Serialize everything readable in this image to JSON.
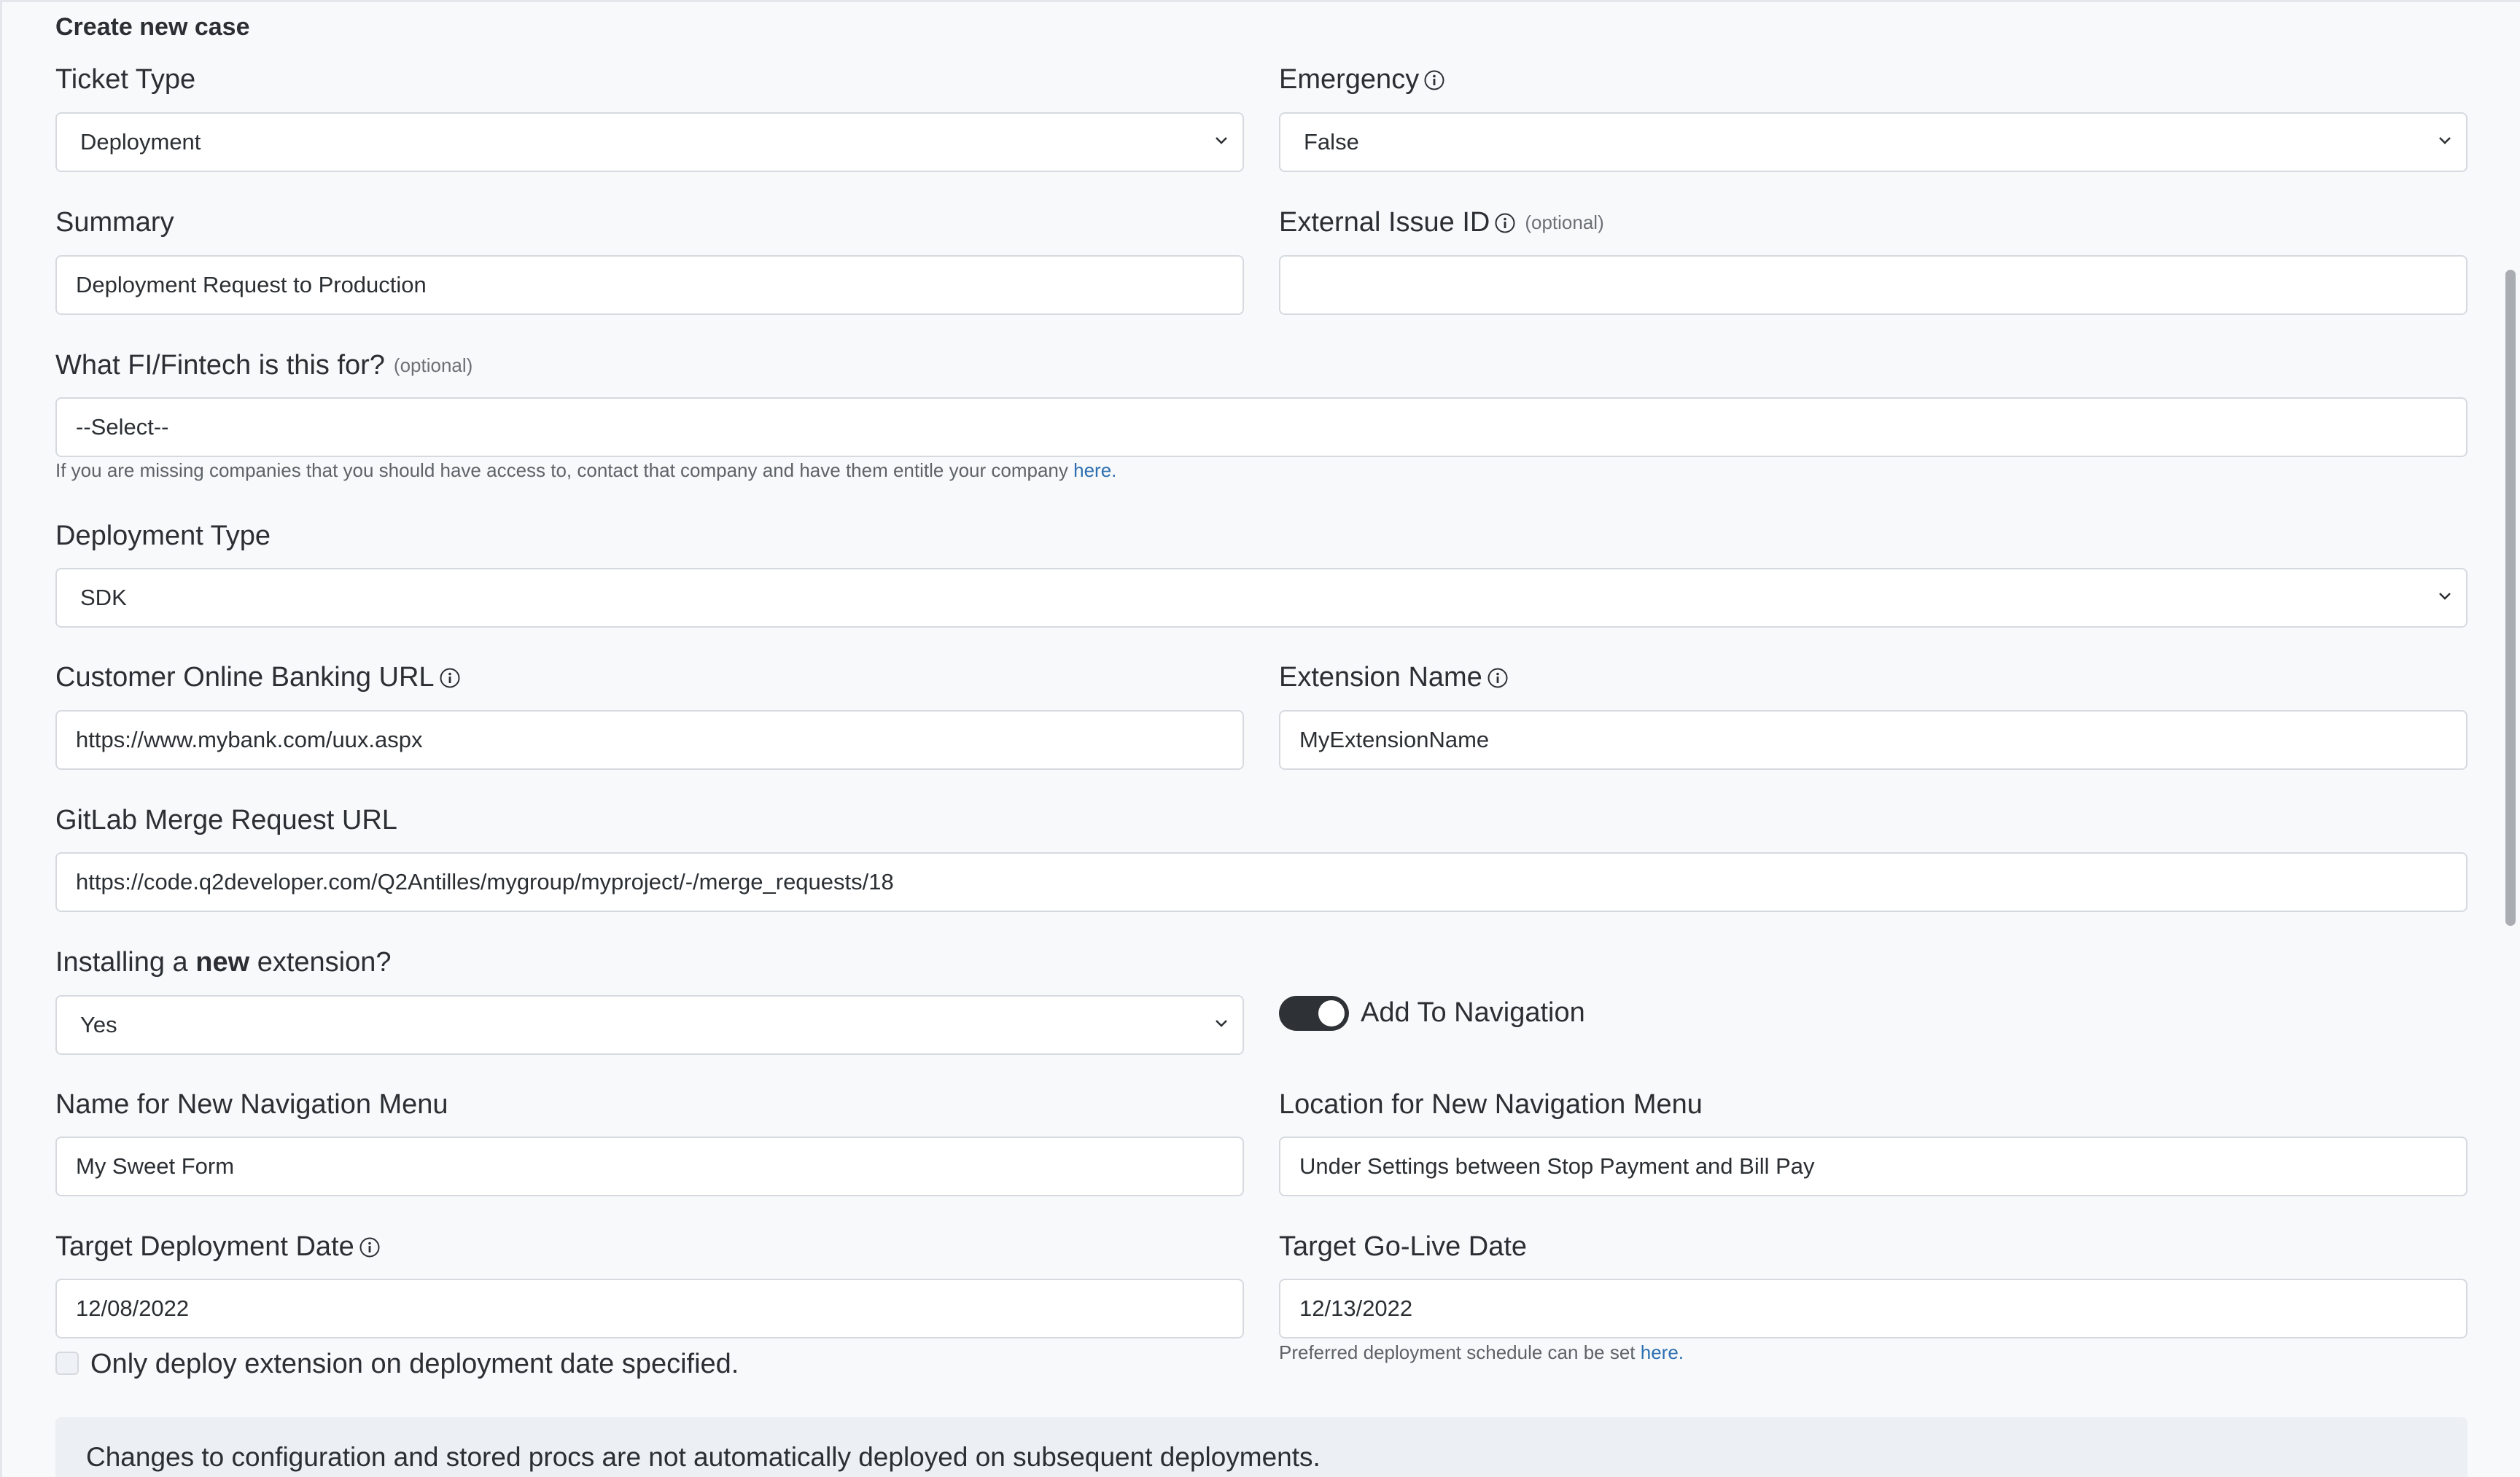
{
  "page": {
    "title": "Create new case"
  },
  "ticket_type": {
    "label": "Ticket Type",
    "value": "Deployment"
  },
  "emergency": {
    "label": "Emergency",
    "value": "False"
  },
  "summary": {
    "label": "Summary",
    "value": "Deployment Request to Production"
  },
  "external_issue": {
    "label": "External Issue ID",
    "optional": "(optional)",
    "value": ""
  },
  "fi_fintech": {
    "label": "What FI/Fintech is this for?",
    "optional": "(optional)",
    "value": "--Select--",
    "help_text": "If you are missing companies that you should have access to, contact that company and have them entitle your company",
    "help_link": "here."
  },
  "deployment_type": {
    "label": "Deployment Type",
    "value": "SDK"
  },
  "banking_url": {
    "label": "Customer Online Banking URL",
    "value": "https://www.mybank.com/uux.aspx"
  },
  "extension_name": {
    "label": "Extension Name",
    "value": "MyExtensionName"
  },
  "gitlab": {
    "label": "GitLab Merge Request URL",
    "value": "https://code.q2developer.com/Q2Antilles/mygroup/myproject/-/merge_requests/18"
  },
  "new_extension": {
    "label_pre": "Installing a",
    "label_bold": "new",
    "label_post": "extension?",
    "value": "Yes"
  },
  "add_navigation": {
    "label": "Add To Navigation",
    "enabled": true
  },
  "nav_name": {
    "label": "Name for New Navigation Menu",
    "value": "My Sweet Form"
  },
  "nav_location": {
    "label": "Location for New Navigation Menu",
    "value": "Under Settings between Stop Payment and Bill Pay"
  },
  "target_deploy": {
    "label": "Target Deployment Date",
    "value": "12/08/2022"
  },
  "target_golive": {
    "label": "Target Go-Live Date",
    "value": "12/13/2022",
    "help_text": "Preferred deployment schedule can be set",
    "help_link": "here."
  },
  "only_deploy": {
    "label": "Only deploy extension on deployment date specified.",
    "checked": false
  },
  "notice": {
    "text": "Changes to configuration and stored procs are not automatically deployed on subsequent deployments."
  },
  "colors": {
    "link": "#2d6fb0",
    "toggle_on": "#2e3236",
    "field_border": "#d6dadf"
  },
  "icons": {
    "info": "info-circle-icon",
    "chevron": "chevron-down-icon"
  }
}
